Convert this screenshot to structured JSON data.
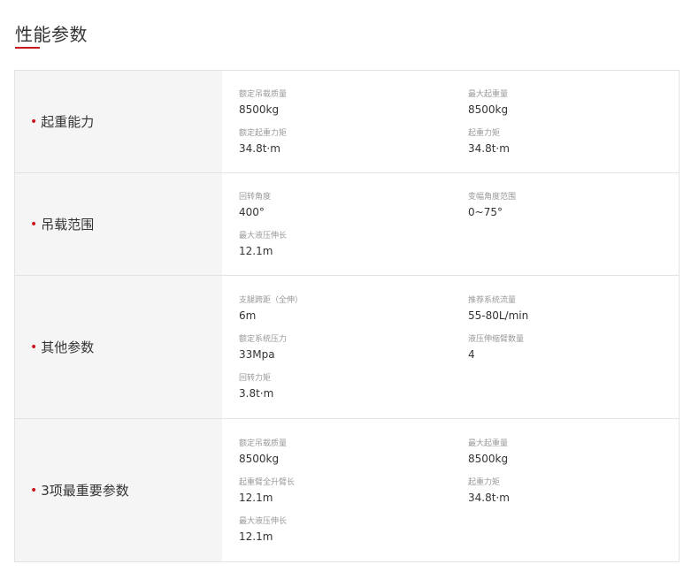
{
  "header": {
    "title": "性能参数"
  },
  "rows": [
    {
      "label": "起重能力",
      "params": [
        {
          "name": "额定吊载质量",
          "value": "8500kg"
        },
        {
          "name": "最大起重量",
          "value": "8500kg"
        },
        {
          "name": "额定起重力矩",
          "value": "34.8t·m"
        },
        {
          "name": "起重力矩",
          "value": "34.8t·m"
        }
      ]
    },
    {
      "label": "吊载范围",
      "params": [
        {
          "name": "回转角度",
          "value": "400°"
        },
        {
          "name": "变幅角度范围",
          "value": "0~75°"
        },
        {
          "name": "最大液压伸长",
          "value": "12.1m"
        }
      ]
    },
    {
      "label": "其他参数",
      "params": [
        {
          "name": "支腿跨距（全伸）",
          "value": "6m"
        },
        {
          "name": "推荐系统流量",
          "value": "55-80L/min"
        },
        {
          "name": "额定系统压力",
          "value": "33Mpa"
        },
        {
          "name": "液压伸缩臂数量",
          "value": "4"
        },
        {
          "name": "回转力矩",
          "value": "3.8t·m"
        }
      ]
    },
    {
      "label": "3项最重要参数",
      "params": [
        {
          "name": "额定吊载质量",
          "value": "8500kg"
        },
        {
          "name": "最大起重量",
          "value": "8500kg"
        },
        {
          "name": "起重臂全升臂长",
          "value": "12.1m"
        },
        {
          "name": "起重力矩",
          "value": "34.8t·m"
        },
        {
          "name": "最大液压伸长",
          "value": "12.1m"
        }
      ]
    }
  ],
  "colors": {
    "accent": "#c9151e",
    "label_bg": "#f5f5f5",
    "border": "#e3e3e3",
    "param_name": "#999999",
    "text": "#333333"
  }
}
